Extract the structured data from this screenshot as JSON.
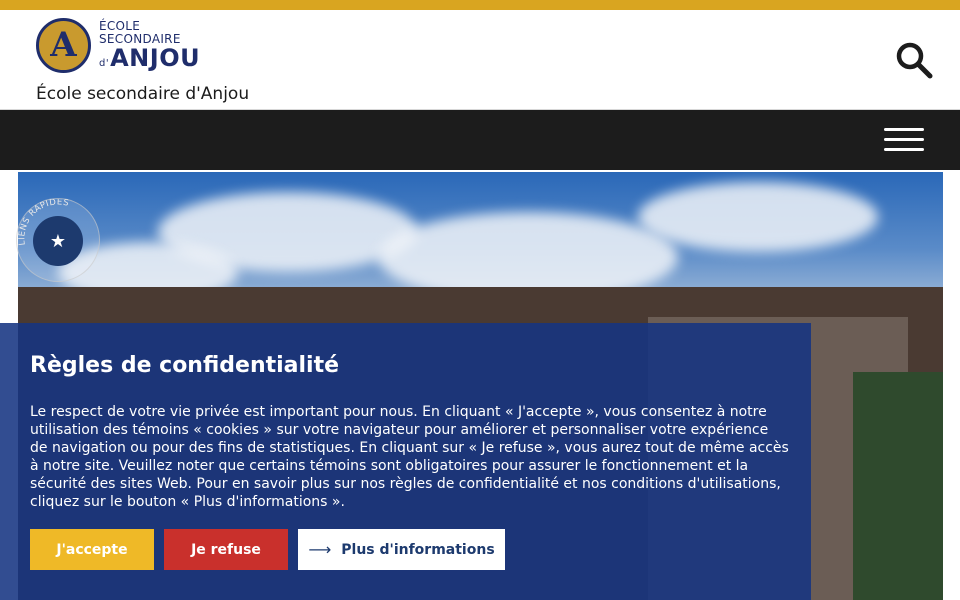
{
  "colors": {
    "top_strip": "#d9a520",
    "navbar": "#1c1c1c",
    "banner_bg": "#163482",
    "accept": "#efb927",
    "refuse": "#c9302c",
    "brand_blue": "#1f2d6b"
  },
  "header": {
    "logo": {
      "badge_letter": "A",
      "line1": "ÉCOLE",
      "line2": "SECONDAIRE",
      "line3_prefix": "d'",
      "line3": "ANJOU"
    },
    "site_name": "École secondaire d'Anjou",
    "search_icon": "search-icon"
  },
  "nav": {
    "menu_icon": "hamburger-menu-icon"
  },
  "quick_links": {
    "label": "LIENS RAPIDES",
    "icon": "star-icon"
  },
  "cookie_banner": {
    "title": "Règles de confidentialité",
    "body": "Le respect de votre vie privée est important pour nous. En cliquant « J'accepte », vous consentez à notre utilisation des témoins « cookies » sur votre navigateur pour améliorer et personnaliser votre expérience de navigation ou pour des fins de statistiques. En cliquant sur « Je refuse », vous aurez tout de même accès à notre site. Veuillez noter que certains témoins sont obligatoires pour assurer le fonctionnement et la sécurité des sites Web. Pour en savoir plus sur nos règles de confidentialité et nos conditions d'utilisations, cliquez sur le bouton « Plus d'informations ».",
    "accept_label": "J'accepte",
    "refuse_label": "Je refuse",
    "more_label": "Plus d'informations",
    "more_icon": "arrow-right-icon"
  }
}
